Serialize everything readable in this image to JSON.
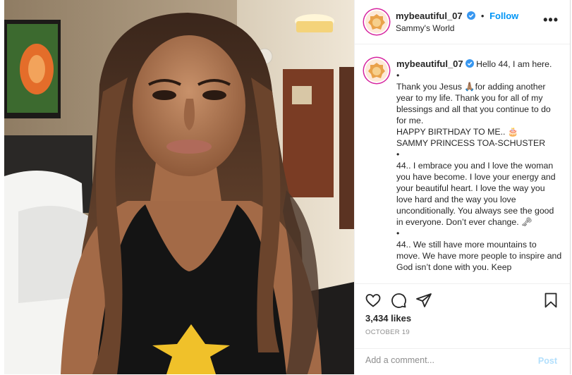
{
  "account": {
    "username": "mybeautiful_07",
    "location": "Sammy's World",
    "follow_label": "Follow",
    "separator": "•",
    "more_label": "•••",
    "verified_icon": "verified-badge-icon",
    "avatar_icon": "lion-logo-icon"
  },
  "caption": {
    "username": "mybeautiful_07",
    "lines": [
      "Hello 44, I am here.",
      "•",
      "Thank you Jesus 🙏🏽for adding another year to my life. Thank you for all of my blessings and all that you continue to do for me.",
      "HAPPY BIRTHDAY TO ME.. 🎂",
      "SAMMY PRINCESS TOA-SCHUSTER",
      "•",
      "44.. I embrace you and I love the woman you have become. I love your energy and your beautiful heart. I love the way you love hard and the way you love unconditionally. You always see the good in everyone. Don’t ever change. 🗝",
      "•",
      "44.. We still have more mountains to move. We have more people to inspire and God isn’t done with you. Keep"
    ]
  },
  "actions": {
    "icons": [
      "heart-icon",
      "comment-icon",
      "share-icon",
      "bookmark-icon"
    ],
    "likes": "3,434 likes",
    "date": "OCTOBER 19"
  },
  "comment": {
    "placeholder": "Add a comment...",
    "post_label": "Post"
  },
  "colors": {
    "accent": "#0095f6",
    "verified": "#3897f0",
    "post_disabled": "#b2dffc",
    "secondary_text": "#8e8e8e"
  }
}
